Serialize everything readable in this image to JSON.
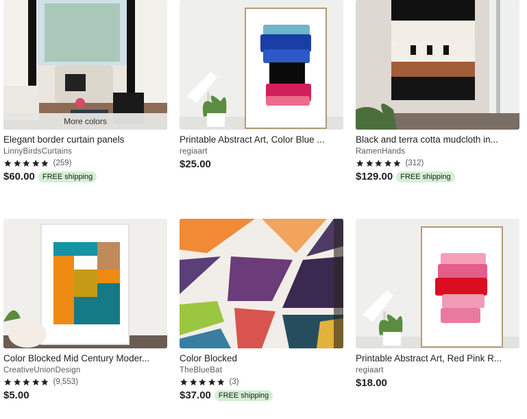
{
  "listings": [
    {
      "title": "Elegant border curtain panels",
      "shop": "LinnyBirdsCurtains",
      "rating_count": "(259)",
      "price": "$60.00",
      "free_shipping": "FREE shipping",
      "more_colors": "More colors"
    },
    {
      "title": "Printable Abstract Art, Color Blue ...",
      "shop": "regiaart",
      "price": "$25.00"
    },
    {
      "title": "Black and terra cotta mudcloth in...",
      "shop": "RamenHands",
      "rating_count": "(312)",
      "price": "$129.00",
      "free_shipping": "FREE shipping"
    },
    {
      "title": "Color Blocked Mid Century Moder...",
      "shop": "CreativeUnionDesign",
      "rating_count": "(9,553)",
      "price": "$5.00"
    },
    {
      "title": "Color Blocked",
      "shop": "TheBlueBat",
      "rating_count": "(3)",
      "price": "$37.00",
      "free_shipping": "FREE shipping"
    },
    {
      "title": "Printable Abstract Art, Red Pink R...",
      "shop": "regiaart",
      "price": "$18.00"
    }
  ],
  "ratings": {
    "stars": 5
  },
  "colors": {
    "free_shipping_bg": "#d4f0d4",
    "star": "#222222"
  }
}
